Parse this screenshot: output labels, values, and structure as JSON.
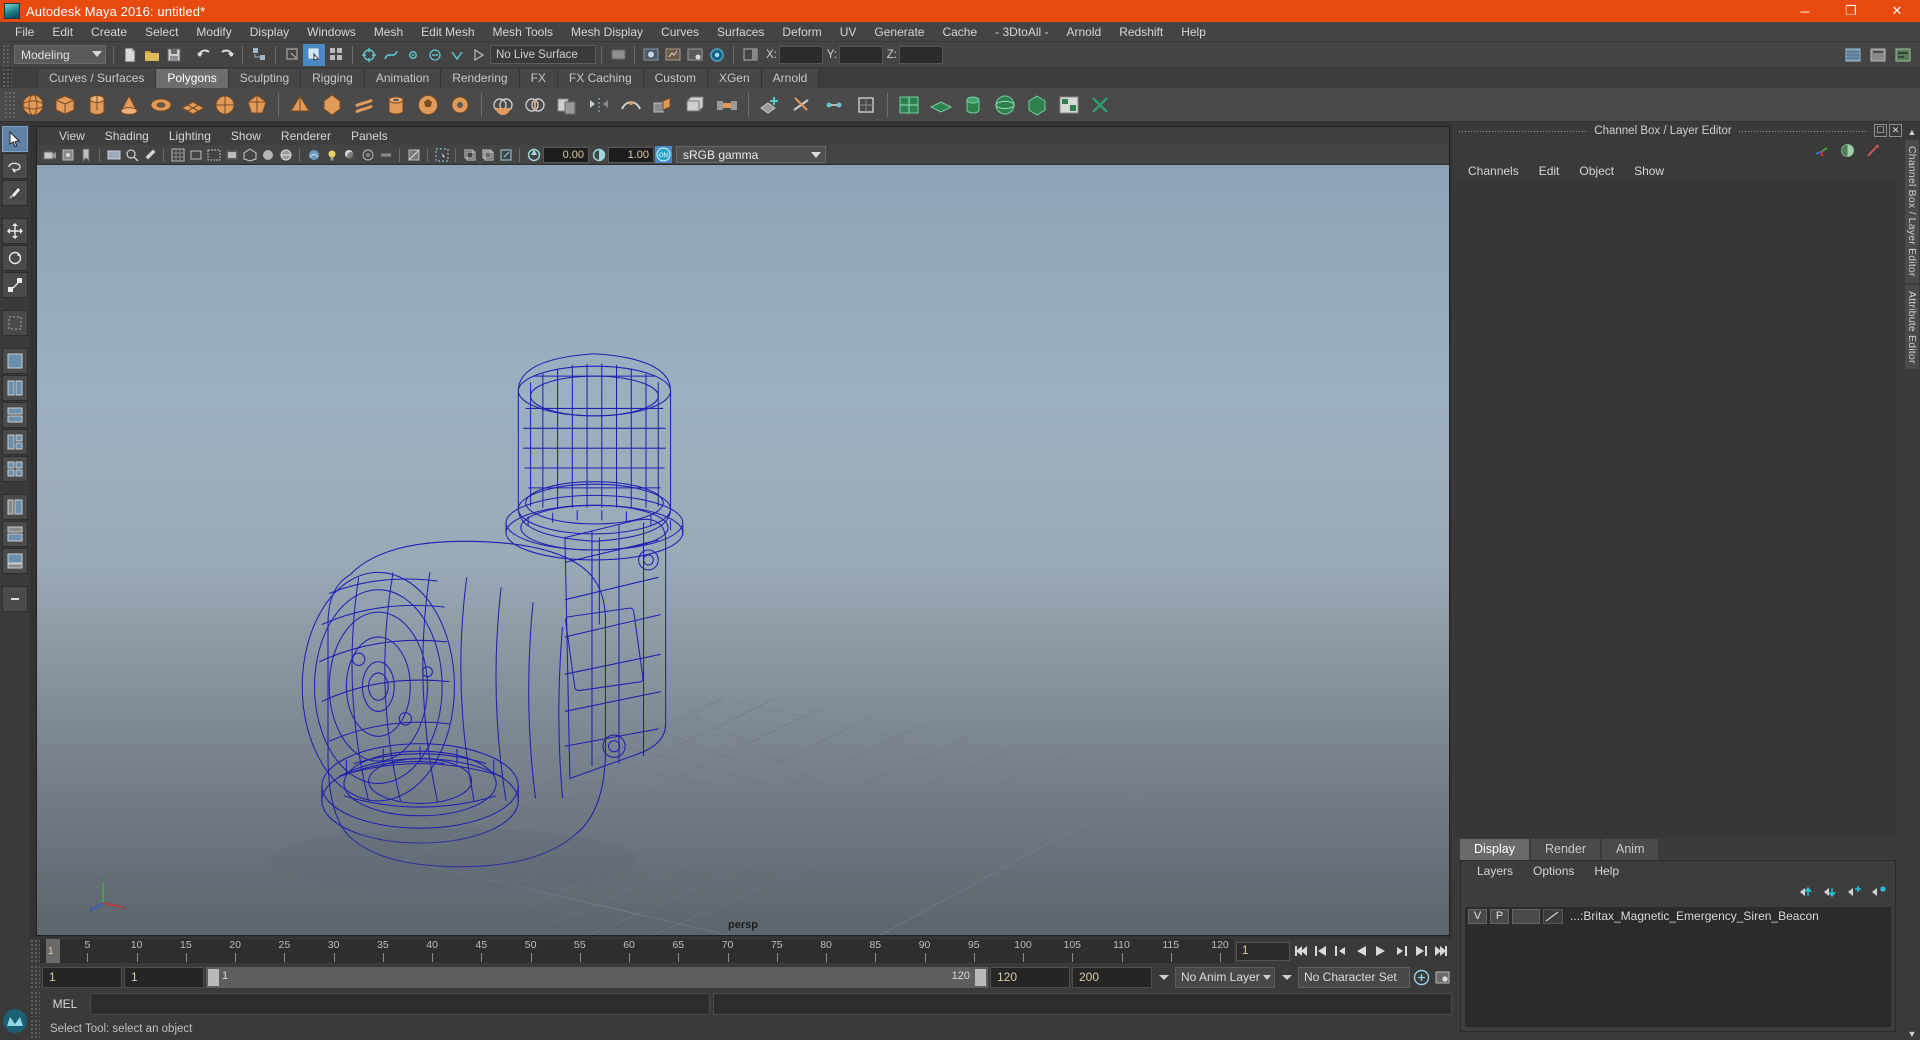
{
  "window": {
    "title": "Autodesk Maya 2016: untitled*",
    "icon": "maya-app-icon",
    "minimize": "─",
    "maximize": "❐",
    "close": "✕"
  },
  "menubar": {
    "items": [
      {
        "label": "File"
      },
      {
        "label": "Edit"
      },
      {
        "label": "Create"
      },
      {
        "label": "Select"
      },
      {
        "label": "Modify"
      },
      {
        "label": "Display"
      },
      {
        "label": "Windows"
      },
      {
        "label": "Mesh"
      },
      {
        "label": "Edit Mesh"
      },
      {
        "label": "Mesh Tools"
      },
      {
        "label": "Mesh Display"
      },
      {
        "label": "Curves"
      },
      {
        "label": "Surfaces"
      },
      {
        "label": "Deform"
      },
      {
        "label": "UV"
      },
      {
        "label": "Generate"
      },
      {
        "label": "Cache"
      },
      {
        "label": "- 3DtoAll -"
      },
      {
        "label": "Arnold"
      },
      {
        "label": "Redshift"
      },
      {
        "label": "Help"
      }
    ]
  },
  "statusbar": {
    "mode": "Modeling",
    "live_surface": "No Live Surface",
    "x_label": "X:",
    "y_label": "Y:",
    "z_label": "Z:",
    "x_value": "",
    "y_value": "",
    "z_value": ""
  },
  "shelf_tabs": {
    "items": [
      {
        "label": "Curves / Surfaces",
        "selected": false
      },
      {
        "label": "Polygons",
        "selected": true
      },
      {
        "label": "Sculpting",
        "selected": false
      },
      {
        "label": "Rigging",
        "selected": false
      },
      {
        "label": "Animation",
        "selected": false
      },
      {
        "label": "Rendering",
        "selected": false
      },
      {
        "label": "FX",
        "selected": false
      },
      {
        "label": "FX Caching",
        "selected": false
      },
      {
        "label": "Custom",
        "selected": false
      },
      {
        "label": "XGen",
        "selected": false
      },
      {
        "label": "Arnold",
        "selected": false
      }
    ]
  },
  "shelf": {
    "icons": [
      "poly-sphere-icon",
      "poly-cube-icon",
      "poly-cylinder-icon",
      "poly-cone-icon",
      "poly-torus-icon",
      "poly-plane-icon",
      "poly-disc-icon",
      "poly-platonic-icon",
      "poly-pyramid-icon",
      "poly-prism-icon",
      "poly-helix-icon",
      "poly-pipe-icon",
      "poly-soccer-ball-icon",
      "poly-gear-icon",
      "combine-icon",
      "separate-icon",
      "booleans-icon",
      "mirror-icon",
      "smooth-icon",
      "extrude-icon",
      "bevel-icon",
      "bridge-icon",
      "append-polygon-icon",
      "wedge-icon",
      "multi-cut-icon",
      "target-weld-icon",
      "quad-draw-icon",
      "sculpt-icon",
      "uv-editor-icon",
      "uv-planar-icon",
      "uv-cylindrical-icon",
      "uv-spherical-icon",
      "uv-automatic-icon",
      "uv-layout-icon",
      "uv-cut-icon"
    ]
  },
  "toolbox": {
    "tools": [
      {
        "name": "select-tool",
        "selected": true
      },
      {
        "name": "lasso-select-tool",
        "selected": false
      },
      {
        "name": "paint-select-tool",
        "selected": false
      },
      {
        "name": "move-tool",
        "selected": false
      },
      {
        "name": "rotate-tool",
        "selected": false
      },
      {
        "name": "scale-tool",
        "selected": false
      },
      {
        "name": "last-tool",
        "selected": false
      },
      {
        "name": "layout-single-pane",
        "selected": false
      },
      {
        "name": "layout-two-pane-side",
        "selected": false
      },
      {
        "name": "layout-two-pane-stacked",
        "selected": false
      },
      {
        "name": "layout-three-pane",
        "selected": false
      },
      {
        "name": "layout-four-pane",
        "selected": false
      },
      {
        "name": "layout-persp-outliner",
        "selected": false
      },
      {
        "name": "layout-hypergraph",
        "selected": false
      },
      {
        "name": "layout-persp-graph",
        "selected": false
      },
      {
        "name": "layout-more",
        "selected": false
      }
    ]
  },
  "viewport": {
    "panel_title": "persp",
    "menus": [
      {
        "label": "View"
      },
      {
        "label": "Shading"
      },
      {
        "label": "Lighting"
      },
      {
        "label": "Show"
      },
      {
        "label": "Renderer"
      },
      {
        "label": "Panels"
      }
    ],
    "exposure_value": "0.00",
    "gamma_value": "1.00",
    "color_management": "sRGB gamma",
    "view_gizmo_on": "ON",
    "axis_x": "x",
    "axis_y": "y",
    "axis_z": "z",
    "wireframe_color": "#1a1ab4",
    "bg_top": "#8fa3b8",
    "bg_bottom": "#5d666e"
  },
  "channel_box": {
    "panel_title": "Channel Box / Layer Editor",
    "menus": [
      {
        "label": "Channels"
      },
      {
        "label": "Edit"
      },
      {
        "label": "Object"
      },
      {
        "label": "Show"
      }
    ],
    "icon_buttons": [
      "channel-box-icon",
      "attribute-editor-icon",
      "tool-settings-icon"
    ]
  },
  "layer_editor": {
    "tabs": [
      {
        "label": "Display",
        "selected": true
      },
      {
        "label": "Render",
        "selected": false
      },
      {
        "label": "Anim",
        "selected": false
      }
    ],
    "menus": [
      {
        "label": "Layers"
      },
      {
        "label": "Options"
      },
      {
        "label": "Help"
      }
    ],
    "buttons": [
      "move-layer-up-icon",
      "move-layer-down-icon",
      "new-layer-icon",
      "new-layer-from-selected-icon"
    ],
    "rows": [
      {
        "visibility": "V",
        "playback": "P",
        "shade": "",
        "color_bar": "layer-color-swatch",
        "name": "...:Britax_Magnetic_Emergency_Siren_Beacon"
      }
    ]
  },
  "vertical_tabs": {
    "items": [
      {
        "label": "Channel Box / Layer Editor"
      },
      {
        "label": "Attribute Editor"
      }
    ]
  },
  "timeline": {
    "ticks": [
      5,
      10,
      15,
      20,
      25,
      30,
      35,
      40,
      45,
      50,
      55,
      60,
      65,
      70,
      75,
      80,
      85,
      90,
      95,
      100,
      105,
      110,
      115,
      120
    ],
    "start": 1,
    "end": 120,
    "current_frame": "1",
    "current_frame_field": "1",
    "playback_buttons": [
      "go-to-start-icon",
      "step-back-frame-icon",
      "step-back-key-icon",
      "play-backwards-icon",
      "play-forwards-icon",
      "step-forward-key-icon",
      "step-forward-frame-icon",
      "go-to-end-icon"
    ]
  },
  "range_slider": {
    "anim_start": "1",
    "range_start": "1",
    "slider_left_value": "1",
    "slider_right_value": "120",
    "range_end": "120",
    "anim_end": "200",
    "anim_layer": "No Anim Layer",
    "character_set": "No Character Set",
    "auto_key_icon": "auto-keyframe-icon",
    "anim_prefs_icon": "animation-preferences-icon"
  },
  "command_line": {
    "label": "MEL",
    "input_value": "",
    "output_value": ""
  },
  "help_line": {
    "text": "Select Tool: select an object"
  }
}
